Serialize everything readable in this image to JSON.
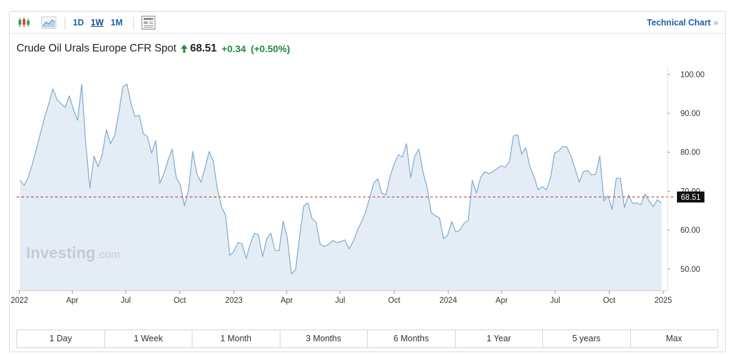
{
  "toolbar": {
    "icons": [
      "candlestick-icon",
      "area-chart-icon",
      "news-panel-icon"
    ],
    "intervals": [
      "1D",
      "1W",
      "1M"
    ],
    "active_interval": "1W",
    "technical_chart_label": "Technical Chart",
    "technical_chart_chevron": "»"
  },
  "header": {
    "instrument": "Crude Oil Urals Europe CFR Spot",
    "last": "68.51",
    "change_abs": "+0.34",
    "change_pct": "(+0.50%)"
  },
  "watermark": {
    "brand": "Investing",
    "suffix": ".com"
  },
  "colors": {
    "line": "#7aa8cf",
    "area_fill": "#e4edf5",
    "reference_line": "#b5342a",
    "price_tag_bg": "#111111",
    "accent_blue": "#1b5fa8",
    "change_green": "#1c8a3c"
  },
  "chart_data": {
    "type": "area",
    "x": [
      "2022-01-02",
      "2022-01-09",
      "2022-01-16",
      "2022-01-23",
      "2022-01-30",
      "2022-02-06",
      "2022-02-13",
      "2022-02-20",
      "2022-02-27",
      "2022-03-06",
      "2022-03-13",
      "2022-03-20",
      "2022-03-27",
      "2022-04-03",
      "2022-04-10",
      "2022-04-17",
      "2022-04-24",
      "2022-05-01",
      "2022-05-08",
      "2022-05-15",
      "2022-05-22",
      "2022-05-29",
      "2022-06-05",
      "2022-06-12",
      "2022-06-19",
      "2022-06-26",
      "2022-07-03",
      "2022-07-10",
      "2022-07-17",
      "2022-07-24",
      "2022-07-31",
      "2022-08-07",
      "2022-08-14",
      "2022-08-21",
      "2022-08-28",
      "2022-09-04",
      "2022-09-11",
      "2022-09-18",
      "2022-09-25",
      "2022-10-02",
      "2022-10-09",
      "2022-10-16",
      "2022-10-23",
      "2022-10-30",
      "2022-11-06",
      "2022-11-13",
      "2022-11-20",
      "2022-11-27",
      "2022-12-04",
      "2022-12-11",
      "2022-12-18",
      "2022-12-25",
      "2023-01-01",
      "2023-01-08",
      "2023-01-15",
      "2023-01-22",
      "2023-01-29",
      "2023-02-05",
      "2023-02-12",
      "2023-02-19",
      "2023-02-26",
      "2023-03-05",
      "2023-03-12",
      "2023-03-19",
      "2023-03-26",
      "2023-04-02",
      "2023-04-09",
      "2023-04-16",
      "2023-04-23",
      "2023-04-30",
      "2023-05-07",
      "2023-05-14",
      "2023-05-21",
      "2023-05-28",
      "2023-06-04",
      "2023-06-11",
      "2023-06-18",
      "2023-06-25",
      "2023-07-02",
      "2023-07-09",
      "2023-07-16",
      "2023-07-23",
      "2023-07-30",
      "2023-08-06",
      "2023-08-13",
      "2023-08-20",
      "2023-08-27",
      "2023-09-03",
      "2023-09-10",
      "2023-09-17",
      "2023-09-24",
      "2023-10-01",
      "2023-10-08",
      "2023-10-15",
      "2023-10-22",
      "2023-10-29",
      "2023-11-05",
      "2023-11-12",
      "2023-11-19",
      "2023-11-26",
      "2023-12-03",
      "2023-12-10",
      "2023-12-17",
      "2023-12-24",
      "2023-12-31",
      "2024-01-07",
      "2024-01-14",
      "2024-01-21",
      "2024-01-28",
      "2024-02-04",
      "2024-02-11",
      "2024-02-18",
      "2024-02-25",
      "2024-03-03",
      "2024-03-10",
      "2024-03-17",
      "2024-03-24",
      "2024-03-31",
      "2024-04-07",
      "2024-04-14",
      "2024-04-21",
      "2024-04-28",
      "2024-05-05",
      "2024-05-12",
      "2024-05-19",
      "2024-05-26",
      "2024-06-02",
      "2024-06-09",
      "2024-06-16",
      "2024-06-23",
      "2024-06-30",
      "2024-07-07",
      "2024-07-14",
      "2024-07-21",
      "2024-07-28",
      "2024-08-04",
      "2024-08-11",
      "2024-08-18",
      "2024-08-25",
      "2024-09-01",
      "2024-09-08",
      "2024-09-15",
      "2024-09-22",
      "2024-09-29",
      "2024-10-06",
      "2024-10-13",
      "2024-10-20",
      "2024-10-27",
      "2024-11-03",
      "2024-11-10",
      "2024-11-17",
      "2024-11-24",
      "2024-12-01",
      "2024-12-08",
      "2024-12-15",
      "2024-12-22",
      "2024-12-29"
    ],
    "y": [
      72.8,
      71.5,
      73.5,
      77.0,
      81.0,
      85.0,
      89.0,
      92.5,
      96.3,
      93.5,
      92.5,
      91.5,
      94.5,
      91.0,
      88.2,
      97.5,
      82.0,
      70.8,
      79.0,
      76.3,
      79.5,
      85.8,
      82.2,
      84.2,
      90.0,
      96.8,
      97.5,
      92.5,
      89.2,
      89.5,
      84.8,
      84.0,
      79.8,
      83.0,
      72.0,
      74.5,
      78.0,
      80.8,
      73.5,
      71.5,
      66.2,
      70.5,
      80.2,
      74.5,
      72.3,
      76.0,
      80.2,
      77.8,
      70.5,
      66.0,
      63.8,
      53.5,
      54.5,
      56.8,
      56.5,
      52.7,
      56.5,
      59.2,
      58.8,
      53.2,
      57.8,
      59.2,
      54.8,
      54.7,
      62.3,
      58.0,
      48.8,
      49.8,
      58.5,
      66.2,
      67.0,
      63.0,
      62.0,
      56.3,
      55.8,
      56.3,
      57.3,
      56.8,
      57.0,
      57.5,
      55.2,
      57.0,
      59.8,
      62.0,
      64.5,
      68.2,
      72.0,
      73.2,
      69.5,
      69.0,
      73.8,
      77.0,
      79.3,
      78.8,
      82.2,
      73.5,
      79.0,
      80.8,
      75.0,
      71.0,
      64.5,
      63.7,
      63.2,
      57.8,
      58.7,
      62.2,
      59.5,
      60.0,
      61.8,
      62.5,
      72.8,
      69.5,
      73.5,
      75.0,
      74.5,
      75.0,
      75.8,
      76.5,
      76.2,
      77.5,
      84.2,
      84.5,
      79.5,
      81.2,
      76.3,
      73.8,
      70.3,
      71.2,
      70.3,
      73.3,
      79.8,
      80.3,
      81.5,
      81.3,
      79.0,
      75.8,
      72.3,
      75.0,
      75.3,
      74.2,
      74.3,
      79.0,
      67.5,
      68.8,
      65.3,
      73.3,
      73.3,
      65.8,
      69.0,
      66.8,
      67.0,
      66.5,
      69.3,
      67.5,
      66.0,
      67.8,
      67.0,
      67.5,
      68.51
    ],
    "y_ticks": [
      "100.00",
      "90.00",
      "80.00",
      "70.00",
      "60.00",
      "50.00"
    ],
    "y_tick_values": [
      100,
      90,
      80,
      70,
      60,
      50
    ],
    "x_tick_labels": [
      "2022",
      "Apr",
      "Jul",
      "Oct",
      "2023",
      "Apr",
      "Jul",
      "Oct",
      "2024",
      "Apr",
      "Jul",
      "Oct",
      "2025"
    ],
    "x_tick_dates": [
      "2022-01-01",
      "2022-04-01",
      "2022-07-01",
      "2022-10-01",
      "2023-01-01",
      "2023-04-01",
      "2023-07-01",
      "2023-10-01",
      "2024-01-01",
      "2024-04-01",
      "2024-07-01",
      "2024-10-01",
      "2025-01-01"
    ],
    "x_range": [
      "2021-12-27",
      "2025-01-08"
    ],
    "ylim": [
      44.5,
      102
    ],
    "last_value": 68.51,
    "last_value_label": "68.51",
    "grid": false,
    "axis_position": "right"
  },
  "ranges": [
    "1 Day",
    "1 Week",
    "1 Month",
    "3 Months",
    "6 Months",
    "1 Year",
    "5 years",
    "Max"
  ]
}
